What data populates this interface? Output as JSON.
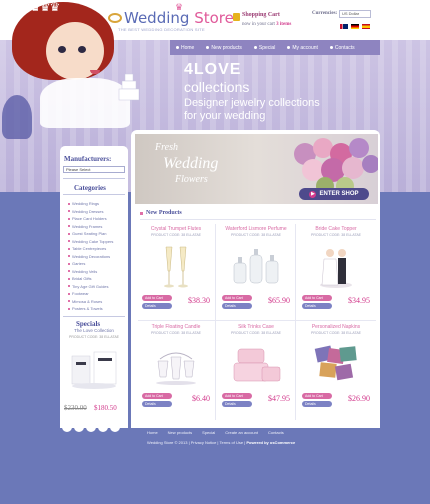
{
  "header": {
    "logo_title": "Wedding",
    "logo_title_accent": "Store",
    "logo_tagline": "THE BEST WEDDING DECORATION SITE",
    "cart_title": "Shopping Cart",
    "cart_line": "now in your cart",
    "cart_count": "3 items",
    "currencies_label": "Currencies:",
    "currency_selected": "US Dollar"
  },
  "nav": {
    "items": [
      "Home",
      "New products",
      "Special",
      "My account",
      "Contacts"
    ]
  },
  "banner": {
    "line1": "4LOVE",
    "line2": "collections",
    "line3": "Designer jewelry collections",
    "line4": "for your wedding"
  },
  "sidebar": {
    "manufacturers_title": "Manufacturers:",
    "manufacturers_selected": "Please Select",
    "categories_title": "Categories",
    "categories": [
      "Wedding Rings",
      "Wedding Dresses",
      "Place Card Holders",
      "Wedding Frames",
      "Guest Seating Plan",
      "Wedding Cake Toppers",
      "Table Centrepieces",
      "Wedding Decorations",
      "Garters",
      "Wedding Veils",
      "Bridal Gifts",
      "Tiny Age Gift Guides",
      "Footwear",
      "Mimosa & Roses",
      "Posters & Towels"
    ],
    "specials_title": "Specials",
    "special_item": "The Love Collection",
    "special_code": "PRODUCT CODE: 38 ELLATAE",
    "special_old_price": "$230.00",
    "special_new_price": "$180.50"
  },
  "hero": {
    "text1": "Fresh",
    "text2": "Wedding",
    "text3": "Flowers",
    "button": "ENTER SHOP"
  },
  "products": {
    "section_title": "New Products",
    "add_to_cart": "Add to Cart",
    "details": "Details",
    "items": [
      {
        "title": "Crystal Trumpet Flutes",
        "code": "PRODUCT CODE: 38 ELLATAE",
        "price": "$38.30"
      },
      {
        "title": "Waterford Lismore Perfume",
        "code": "PRODUCT CODE: 38 ELLATAE",
        "price": "$65.90"
      },
      {
        "title": "Bride Cake Topper",
        "code": "PRODUCT CODE: 38 ELLATAE",
        "price": "$34.95"
      },
      {
        "title": "Triple Floating Candle",
        "code": "PRODUCT CODE: 38 ELLATAE",
        "price": "$6.40"
      },
      {
        "title": "Silk Trinks Case",
        "code": "PRODUCT CODE: 38 ELLATAE",
        "price": "$47.95"
      },
      {
        "title": "Personalized Napkins",
        "code": "PRODUCT CODE: 38 ELLATAE",
        "price": "$26.90"
      }
    ]
  },
  "footer": {
    "links": [
      "Home",
      "New products",
      "Special",
      "Create an account",
      "Contacts"
    ],
    "copyright": "Wedding Store © 2013",
    "privacy": "Privacy Notice",
    "terms": "Terms of Use",
    "powered": "Powered by osCommerce"
  },
  "colors": {
    "background": "#6b78b8",
    "accent_pink": "#d23a8c",
    "nav_purple": "#8e84c0",
    "heading_blue": "#4a4f9a"
  }
}
